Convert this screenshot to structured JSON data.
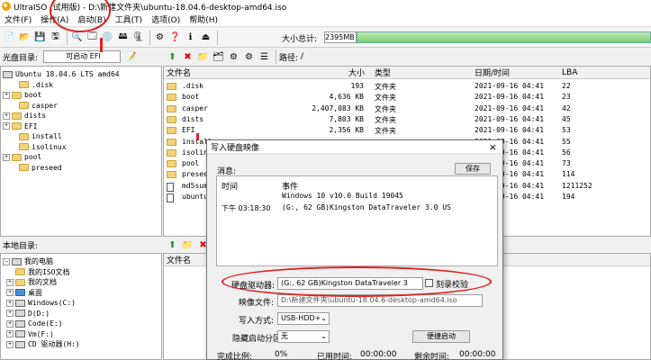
{
  "window": {
    "title": "UltraISO (试用版) - D:\\新建文件夹\\ubuntu-18.04.6-desktop-amd64.iso"
  },
  "menu": [
    "文件(F)",
    "操作(A)",
    "启动(B)",
    "工具(T)",
    "选项(O)",
    "帮助(H)"
  ],
  "toolbar": {
    "size_label": "大小总计:",
    "size_value": "2395MB"
  },
  "image_pane": {
    "label": "光盘目录:",
    "boot_button": "可启动 EFI",
    "path_label": "路径:",
    "path_value": "/",
    "tree_root": "Ubuntu 18.04.6 LTS amd64",
    "tree": [
      ".disk",
      "boot",
      "casper",
      "dists",
      "EFI",
      "install",
      "isolinux",
      "pool",
      "preseed"
    ]
  },
  "file_list": {
    "columns": [
      "文件名",
      "大小",
      "类型",
      "日期/时间",
      "LBA"
    ],
    "rows": [
      {
        "name": ".disk",
        "size": "193",
        "type": "文件夹",
        "date": "2021-09-16 04:41",
        "lba": "22"
      },
      {
        "name": "boot",
        "size": "4,636 KB",
        "type": "文件夹",
        "date": "2021-09-16 04:41",
        "lba": "23"
      },
      {
        "name": "casper",
        "size": "2,407,083 KB",
        "type": "文件夹",
        "date": "2021-09-16 04:41",
        "lba": "42"
      },
      {
        "name": "dists",
        "size": "7,803 KB",
        "type": "文件夹",
        "date": "2021-09-16 04:41",
        "lba": "45"
      },
      {
        "name": "EFI",
        "size": "2,356 KB",
        "type": "文件夹",
        "date": "2021-09-16 04:41",
        "lba": "53"
      },
      {
        "name": "install",
        "size": "",
        "type": "",
        "date": "2021-09-16 04:41",
        "lba": "55"
      },
      {
        "name": "isolinux",
        "size": "",
        "type": "",
        "date": "2021-09-16 04:41",
        "lba": "56"
      },
      {
        "name": "pool",
        "size": "",
        "type": "",
        "date": "2021-09-16 04:41",
        "lba": "73"
      },
      {
        "name": "preseed",
        "size": "",
        "type": "",
        "date": "2021-09-16 04:41",
        "lba": "114"
      },
      {
        "name": "md5sum.t",
        "size": "",
        "type": "",
        "date": "2021-09-16 04:41",
        "lba": "1211252"
      },
      {
        "name": "ubuntu",
        "size": "",
        "type": "",
        "date": "2021-09-16 04:41",
        "lba": "194"
      }
    ]
  },
  "local_pane": {
    "label": "本地目录:",
    "column": "文件名",
    "tree": [
      "我的电脑",
      "我的ISO文档",
      "我的文档",
      "桌面",
      "Windows(C:)",
      "D(D:)",
      "Code(E:)",
      "Vm(F:)",
      "CD 驱动器(H:)"
    ]
  },
  "dialog": {
    "title": "写入硬盘映像",
    "close": "×",
    "msg_label": "消息:",
    "save": "保存",
    "log_columns": [
      "时间",
      "事件"
    ],
    "log": [
      {
        "time": "",
        "event": "Windows 10 v10.0 Build 19045"
      },
      {
        "time": "下午 03:18:30",
        "event": "(G:, 62 GB)Kingston DataTraveler 3.0 US"
      }
    ],
    "drive_label": "硬盘驱动器:",
    "drive_value": "(G:, 62 GB)Kingston DataTraveler 3",
    "verify_label": "刻录校验",
    "image_label": "映像文件:",
    "image_value": "D:\\新建文件夹\\ubuntu-18.04.6-desktop-amd64.iso",
    "mode_label": "写入方式:",
    "mode_value": "USB-HDD+",
    "hidden_label": "隐藏启动分区:",
    "hidden_value": "无",
    "boot_button": "便捷启动",
    "progress_label": "完成比例:",
    "progress_value": "0%",
    "elapsed_label": "已用时间:",
    "elapsed_value": "00:00:00",
    "remain_label": "剩余时间:",
    "remain_value": "00:00:00"
  }
}
